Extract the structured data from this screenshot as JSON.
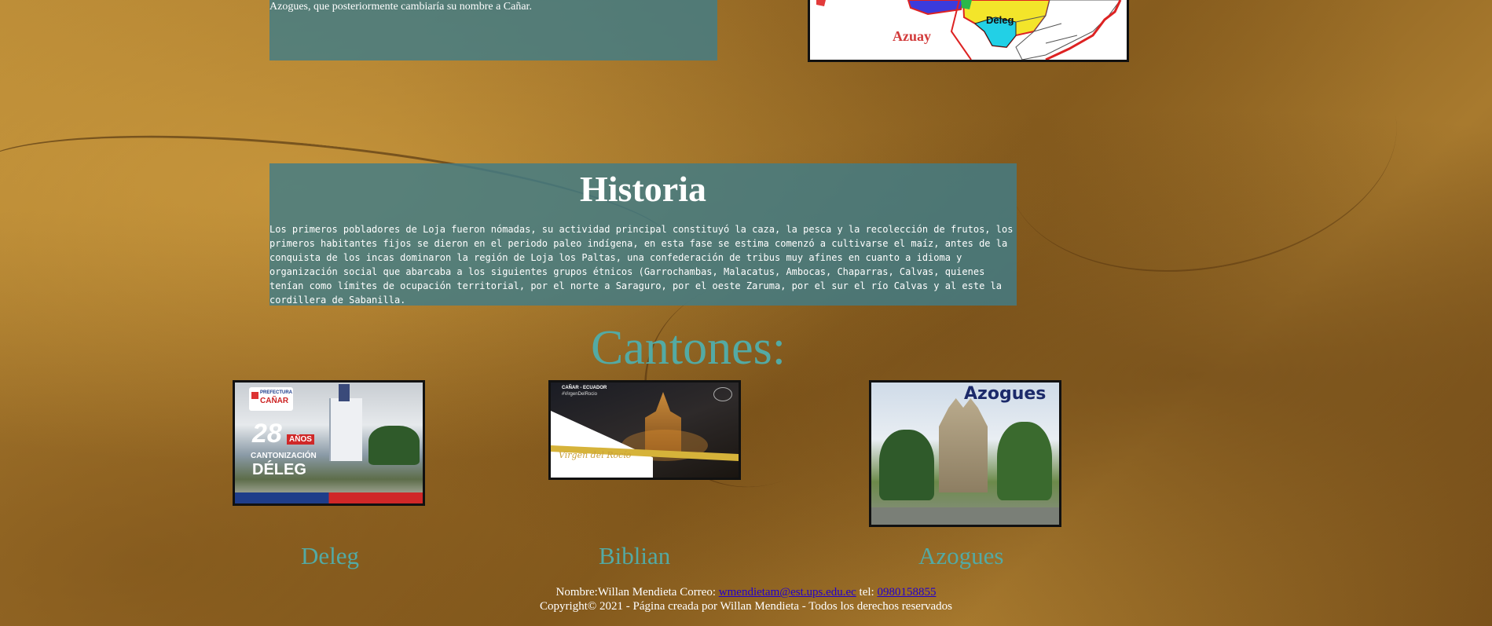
{
  "intro": {
    "text": "Azogues, que posteriormente cambiaría su nombre a Cañar."
  },
  "map": {
    "labels": [
      "Deleg",
      "Azuay"
    ]
  },
  "historia": {
    "title": "Historia",
    "text": "Los primeros pobladores de Loja fueron nómadas, su actividad principal constituyó la caza, la pesca y la recolección de frutos, los primeros habitantes fijos se dieron en el periodo paleo indígena, en esta fase se estima comenzó a cultivarse el maíz, antes de la conquista de los incas dominaron la región de Loja los Paltas, una confederación de tribus muy afines en cuanto a idioma y organización social que abarcaba a los siguientes grupos étnicos (Garrochambas, Malacatus, Ambocas, Chaparras, Calvas, quienes tenían como límites de ocupación territorial, por el norte a Saraguro, por el oeste Zaruma, por el sur el río Calvas y al este la cordillera de Sabanilla."
  },
  "cantones": {
    "title": "Cantones:",
    "items": [
      {
        "name": "Deleg",
        "image_text": [
          "PREFECTURA",
          "CAÑAR",
          "28",
          "AÑOS",
          "CANTONIZACIÓN",
          "DÉLEG"
        ]
      },
      {
        "name": "Biblian",
        "image_text": [
          "CAÑAR - ECUADOR",
          "#VirgenDelRocio",
          "Virgen del Rocío"
        ]
      },
      {
        "name": "Azogues",
        "image_text": [
          "Azogues"
        ]
      }
    ]
  },
  "footer": {
    "nombre_label": "Nombre:Willan Mendieta Correo:",
    "email": "wmendietam@est.ups.edu.ec",
    "tel_label": "tel:",
    "phone": "0980158855",
    "copyright": "Copyright© 2021 - Página creada por Willan Mendieta - Todos los derechos reservados"
  },
  "colors": {
    "panel": "#417d87",
    "accent_text": "#53aaa4",
    "link": "#2200cc",
    "background": "#a3742a"
  }
}
